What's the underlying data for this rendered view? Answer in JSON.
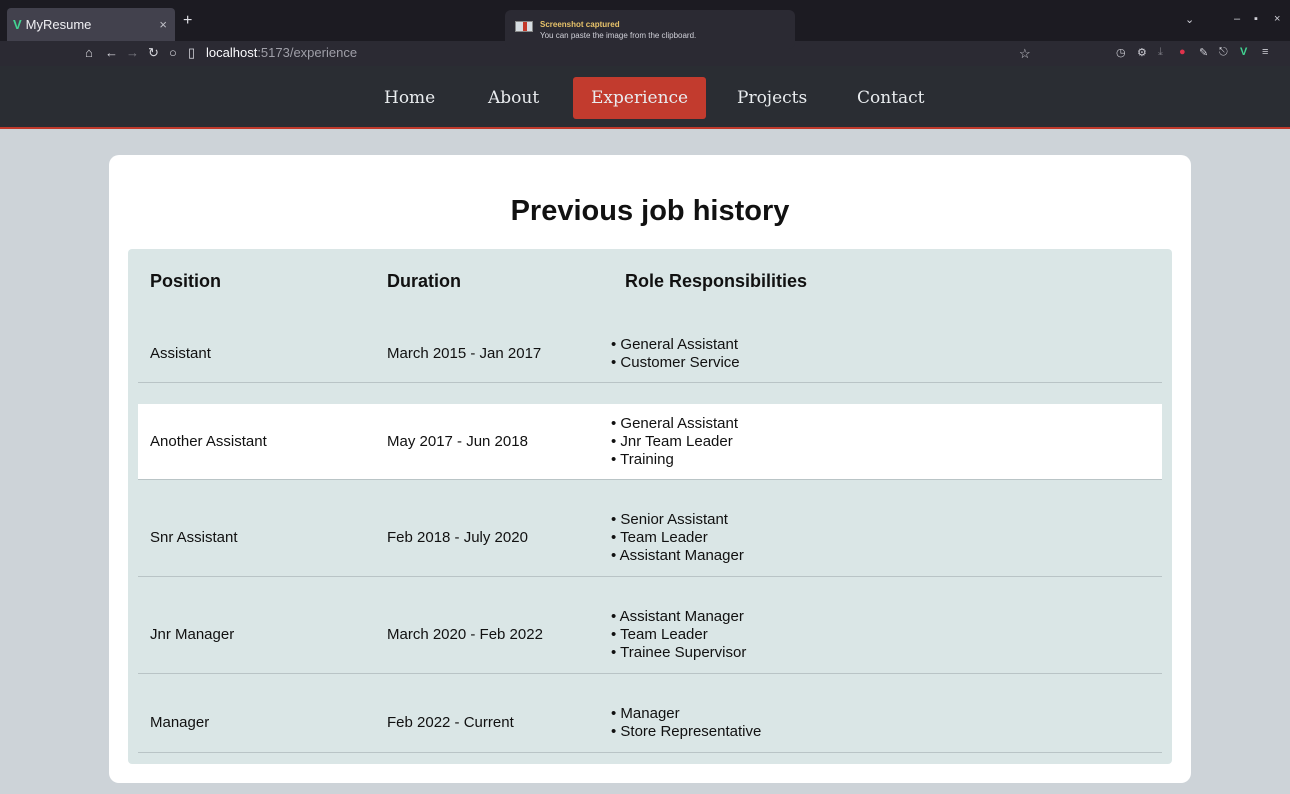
{
  "browser": {
    "tab_title": "MyResume",
    "tab_close": "×",
    "new_tab": "+",
    "url_host": "localhost",
    "url_path": ":5173/experience",
    "notification": {
      "title": "Screenshot captured",
      "message": "You can paste the image from the clipboard."
    }
  },
  "nav": {
    "items": [
      {
        "label": "Home",
        "active": false
      },
      {
        "label": "About",
        "active": false
      },
      {
        "label": "Experience",
        "active": true
      },
      {
        "label": "Projects",
        "active": false
      },
      {
        "label": "Contact",
        "active": false
      }
    ]
  },
  "page": {
    "title": "Previous job history",
    "columns": [
      "Position",
      "Duration",
      "Role Responsibilities"
    ],
    "rows": [
      {
        "position": "Assistant",
        "duration": "March 2015 - Jan 2017",
        "responsibilities": [
          "General Assistant",
          "Customer Service"
        ]
      },
      {
        "position": "Another Assistant",
        "duration": "May 2017 - Jun 2018",
        "responsibilities": [
          "General Assistant",
          "Jnr Team Leader",
          "Training"
        ]
      },
      {
        "position": "Snr Assistant",
        "duration": "Feb 2018 - July 2020",
        "responsibilities": [
          "Senior Assistant",
          "Team Leader",
          "Assistant Manager"
        ]
      },
      {
        "position": "Jnr Manager",
        "duration": "March 2020 - Feb 2022",
        "responsibilities": [
          "Assistant Manager",
          "Team Leader",
          "Trainee Supervisor"
        ]
      },
      {
        "position": "Manager",
        "duration": "Feb 2022 - Current",
        "responsibilities": [
          "Manager",
          "Store Representative"
        ]
      }
    ]
  },
  "colors": {
    "nav_bg": "#2a2d33",
    "accent": "#c23b2e",
    "page_bg": "#cdd3d8",
    "table_bg": "#dae6e6"
  }
}
